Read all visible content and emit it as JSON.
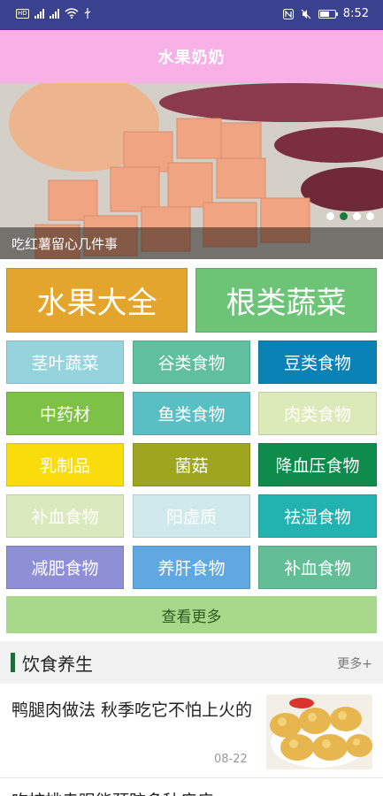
{
  "status_bar": {
    "hd_label": "HD",
    "signal1_label": "4G",
    "signal2_label": "4G",
    "time": "8:52"
  },
  "header": {
    "title": "水果奶奶"
  },
  "banner": {
    "caption": "吃红薯留心几件事",
    "slide_count": 4,
    "active_slide": 2
  },
  "categories": {
    "big": [
      {
        "label": "水果大全",
        "color": "#e3a52c"
      },
      {
        "label": "根类蔬菜",
        "color": "#6dc476"
      }
    ],
    "grid": [
      {
        "label": "茎叶蔬菜",
        "color": "#95d3dd"
      },
      {
        "label": "谷类食物",
        "color": "#5fbf9f"
      },
      {
        "label": "豆类食物",
        "color": "#0b82b6"
      },
      {
        "label": "中药材",
        "color": "#7dc246"
      },
      {
        "label": "鱼类食物",
        "color": "#5abfc5"
      },
      {
        "label": "肉类食物",
        "color": "#dbeab8"
      },
      {
        "label": "乳制品",
        "color": "#f8dc0b"
      },
      {
        "label": "菌菇",
        "color": "#9ea51f"
      },
      {
        "label": "降血压食物",
        "color": "#0f8c4b"
      },
      {
        "label": "补血食物",
        "color": "#dbeabe"
      },
      {
        "label": "阳虚质",
        "color": "#cfe9ed"
      },
      {
        "label": "祛湿食物",
        "color": "#22b2b0"
      },
      {
        "label": "减肥食物",
        "color": "#8f8fd6"
      },
      {
        "label": "养肝食物",
        "color": "#5fa9e0"
      },
      {
        "label": "补血食物",
        "color": "#63bd96"
      }
    ],
    "more_label": "查看更多"
  },
  "section": {
    "title": "饮食养生",
    "more_label": "更多+"
  },
  "articles": [
    {
      "title": "鸭腿肉做法 秋季吃它不怕上火的",
      "date": "08-22",
      "thumb_icon": "fried-food-thumbnail"
    },
    {
      "title": "吃核桃走眼能预防多种疾病"
    }
  ]
}
